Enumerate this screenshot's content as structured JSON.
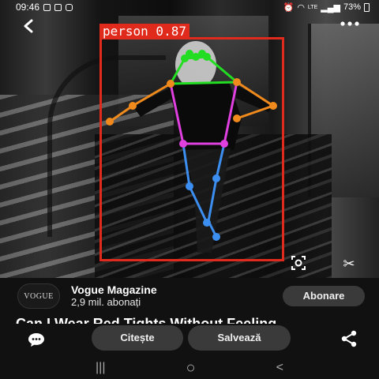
{
  "status_bar": {
    "time": "09:46",
    "battery": "73%",
    "network": "LTE"
  },
  "top_bar": {
    "back_glyph": "‹",
    "more_glyph": "•••"
  },
  "detection": {
    "label": "person 0.87",
    "box_color": "#e02a1b"
  },
  "pose_colors": {
    "head": "#22dd22",
    "arms": "#f08a1c",
    "torso": "#e040e0",
    "legs": "#3c8ff0"
  },
  "account": {
    "logo_text": "VOGUE",
    "name": "Vogue Magazine",
    "subscribers": "2,9 mil. abonați",
    "subscribe_label": "Abonare"
  },
  "article": {
    "title": "Can I Wear Red Tights Without Feeling"
  },
  "actions": {
    "read_label": "Citește",
    "save_label": "Salvează"
  },
  "navbar": {
    "recents": "|||",
    "home": "○",
    "back": "<"
  }
}
